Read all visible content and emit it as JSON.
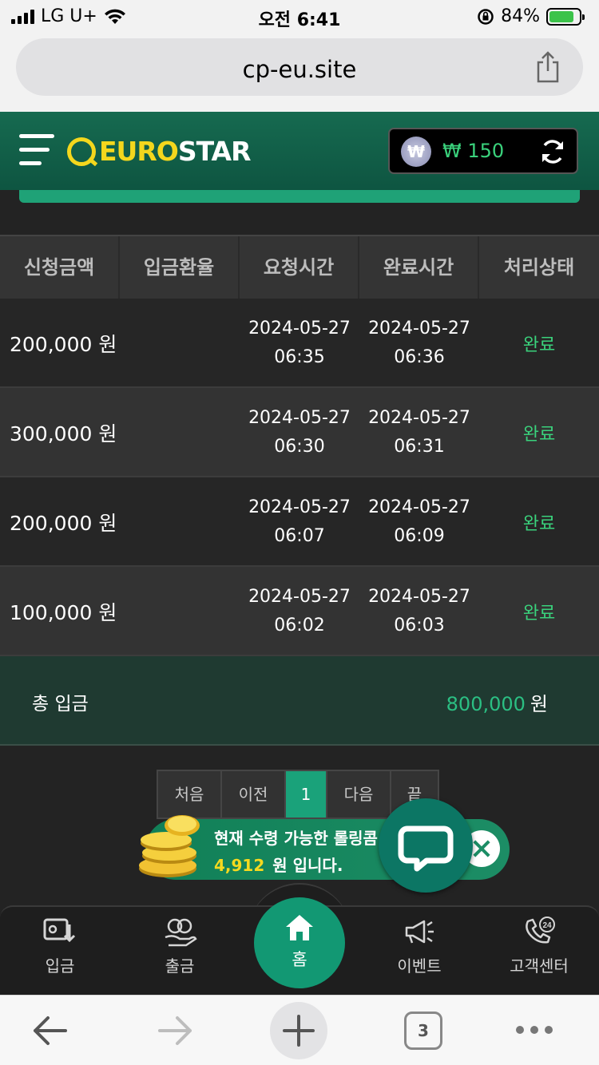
{
  "status_bar": {
    "carrier": "LG U+",
    "time": "오전 6:41",
    "battery_percent": "84%",
    "battery_level": 0.84
  },
  "browser": {
    "url": "cp-eu.site",
    "tab_count": "3"
  },
  "header": {
    "logo_part1": "EURO",
    "logo_part2": "STAR",
    "balance": "₩ 150",
    "currency_symbol": "₩"
  },
  "table": {
    "columns": [
      "신청금액",
      "입금환율",
      "요청시간",
      "완료시간",
      "처리상태"
    ],
    "rows": [
      {
        "amount": "200,000 원",
        "rate": "",
        "request_date": "2024-05-27",
        "request_time": "06:35",
        "complete_date": "2024-05-27",
        "complete_time": "06:36",
        "status": "완료"
      },
      {
        "amount": "300,000 원",
        "rate": "",
        "request_date": "2024-05-27",
        "request_time": "06:30",
        "complete_date": "2024-05-27",
        "complete_time": "06:31",
        "status": "완료"
      },
      {
        "amount": "200,000 원",
        "rate": "",
        "request_date": "2024-05-27",
        "request_time": "06:07",
        "complete_date": "2024-05-27",
        "complete_time": "06:09",
        "status": "완료"
      },
      {
        "amount": "100,000 원",
        "rate": "",
        "request_date": "2024-05-27",
        "request_time": "06:02",
        "complete_date": "2024-05-27",
        "complete_time": "06:03",
        "status": "완료"
      }
    ]
  },
  "total": {
    "label": "총 입금",
    "value": "800,000",
    "unit": "원"
  },
  "pagination": {
    "first": "처음",
    "prev": "이전",
    "current": "1",
    "next": "다음",
    "last": "끝"
  },
  "rolling_banner": {
    "line1": "현재 수령 가능한 롤링콤",
    "amount": "4,912",
    "line2_suffix": "원 입니다."
  },
  "bottom_nav": {
    "deposit": "입금",
    "withdraw": "출금",
    "home": "홈",
    "event": "이벤트",
    "support": "고객센터",
    "support_badge": "24"
  },
  "colors": {
    "brand_green": "#129873",
    "header_green": "#166a50",
    "status_green": "#3ad27c",
    "logo_yellow": "#f4d71d"
  }
}
